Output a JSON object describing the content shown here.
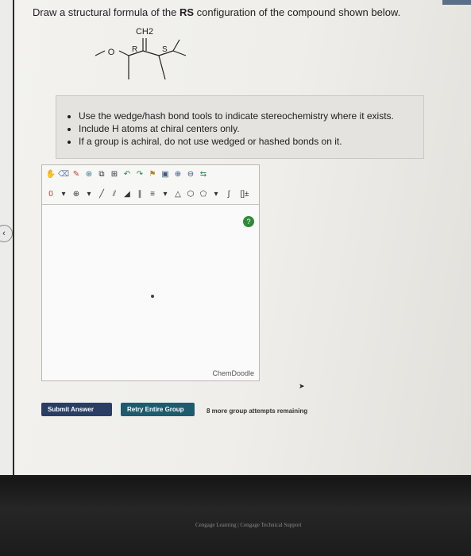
{
  "question": {
    "prefix": "Draw a structural formula of the ",
    "bold": "RS",
    "suffix": " configuration of the compound shown below."
  },
  "molecule": {
    "atom_o": "O",
    "label_r": "R",
    "label_s": "S",
    "group_ch2": "CH2"
  },
  "instructions": [
    "Use the wedge/hash bond tools to indicate stereochemistry where it exists.",
    "Include H atoms at chiral centers only.",
    "If a group is achiral, do not use wedged or hashed bonds on it."
  ],
  "editor": {
    "help_label": "?",
    "branding": "ChemDoodle",
    "atom_selector": "0",
    "bracket_label": "[]±"
  },
  "actions": {
    "submit_label": "Submit Answer",
    "retry_label": "Retry Entire Group",
    "attempts_text": "8 more group attempts remaining"
  },
  "footer": {
    "text": "Cengage Learning | Cengage Technical Support"
  },
  "colors": {
    "submit": "#2a3e63",
    "retry": "#1f5b6e",
    "help": "#2f8b3a"
  }
}
